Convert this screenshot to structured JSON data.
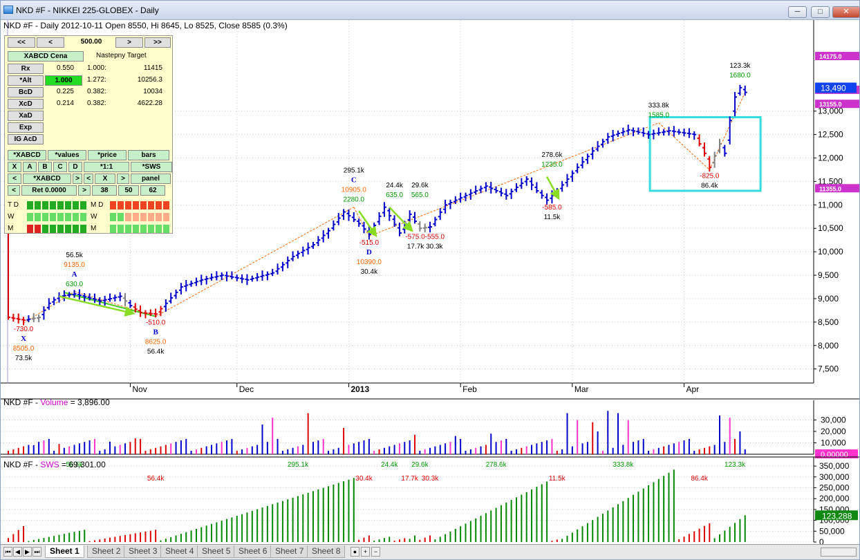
{
  "window": {
    "title": "NKD #F - NIKKEI 225-GLOBEX - Daily",
    "buttons": [
      "─",
      "□",
      "✕"
    ]
  },
  "header": {
    "main": "NKD #F - Daily 2012-10-11 Open 8550, Hi 8645, Lo 8525, Close 8585 (0.3%)"
  },
  "volume_header": {
    "prefix": "NKD #F - ",
    "name": "Volume",
    "suffix": " = 3,896.00"
  },
  "sws_header": {
    "prefix": "NKD #F - ",
    "name": "SWS",
    "suffix": " = 69,301.00"
  },
  "colors": {
    "up": "#0000cc",
    "down": "#dd0000",
    "grey": "#808080",
    "vol_mag": "#ff33cc",
    "sws_green": "#008800",
    "sws_red": "#dd0000",
    "fib_green": "#009900",
    "fib_orange": "#ff6600",
    "highlight_box": "#33dddd",
    "arrow": "#88dd22"
  },
  "dock": {
    "nav": {
      "first": "<<",
      "prev": "<",
      "step": "500.00",
      "next": ">",
      "last": ">>"
    },
    "title": "XABCD Cena",
    "target_label": "Nastepny Target",
    "rows": [
      {
        "name": "Rx",
        "value": "0.550",
        "ratio": "1.000:",
        "target": "11415"
      },
      {
        "name": "*Alt",
        "value": "1.000",
        "ratio": "1.272:",
        "target": "10256.3"
      },
      {
        "name": "BcD",
        "value": "0.225",
        "ratio": "0.382:",
        "target": "10034"
      },
      {
        "name": "XcD",
        "value": "0.214",
        "ratio": "0.382:",
        "target": "4622.28"
      },
      {
        "name": "XaD",
        "value": "",
        "ratio": "",
        "target": ""
      },
      {
        "name": "Exp",
        "value": "",
        "ratio": "",
        "target": ""
      },
      {
        "name": "IG AcD",
        "value": "",
        "ratio": "",
        "target": ""
      }
    ],
    "grid1": [
      "*XABCD",
      "*values",
      "*price",
      "bars"
    ],
    "grid2": [
      "X",
      "A",
      "B",
      "C",
      "D",
      "*1:1",
      "*SWS"
    ],
    "grid3": [
      "<",
      "*XABCD",
      ">",
      "<",
      "X",
      ">",
      "panel"
    ],
    "grid4": [
      "<",
      "Ret 0.0000",
      ">",
      "38",
      "50",
      "62"
    ],
    "tdwm_left": [
      "T D",
      "W",
      "M"
    ],
    "tdwm_right": [
      "M D",
      "W",
      "M"
    ]
  },
  "tabs": [
    "Sheet 1",
    "Sheet 2",
    "Sheet 3",
    "Sheet 4",
    "Sheet 5",
    "Sheet 6",
    "Sheet 7",
    "Sheet 8"
  ],
  "tab_nav": [
    "⏮",
    "◀",
    "▶",
    "⏭"
  ],
  "chart_data": [
    {
      "type": "ohlc",
      "title": "NKD #F - Daily 2012-10-11 Open 8550, Hi 8645, Lo 8525, Close 8585 (0.3%)",
      "ylim": [
        7200,
        14500
      ],
      "y_ticks": [
        "7,500",
        "8,000",
        "8,500",
        "9,000",
        "9,500",
        "10,000",
        "10,500",
        "11,000",
        "11,500",
        "12,000",
        "12,500",
        "13,000"
      ],
      "y_tick_values": [
        7500,
        8000,
        8500,
        9000,
        9500,
        10000,
        10500,
        11000,
        11500,
        12000,
        12500,
        13000
      ],
      "x_labels": [
        "Nov",
        "Dec",
        "2013",
        "Feb",
        "Mar",
        "Apr"
      ],
      "x_label_index": [
        24,
        45,
        67,
        89,
        111,
        133
      ],
      "bar_count": 146,
      "price_anchors": [
        [
          0,
          8600
        ],
        [
          3,
          8540
        ],
        [
          6,
          8600
        ],
        [
          8,
          8900
        ],
        [
          10,
          9050
        ],
        [
          13,
          9100
        ],
        [
          18,
          8950
        ],
        [
          22,
          9050
        ],
        [
          24,
          8850
        ],
        [
          26,
          8700
        ],
        [
          29,
          8670
        ],
        [
          31,
          8900
        ],
        [
          34,
          9250
        ],
        [
          38,
          9400
        ],
        [
          42,
          9500
        ],
        [
          47,
          9400
        ],
        [
          52,
          9550
        ],
        [
          56,
          9900
        ],
        [
          60,
          10150
        ],
        [
          63,
          10450
        ],
        [
          66,
          10850
        ],
        [
          69,
          10600
        ],
        [
          71,
          10370
        ],
        [
          74,
          10950
        ],
        [
          77,
          10400
        ],
        [
          79,
          10800
        ],
        [
          81,
          10500
        ],
        [
          83,
          10530
        ],
        [
          86,
          11000
        ],
        [
          90,
          11200
        ],
        [
          94,
          11400
        ],
        [
          98,
          11200
        ],
        [
          102,
          11550
        ],
        [
          104,
          11300
        ],
        [
          106,
          11100
        ],
        [
          108,
          11300
        ],
        [
          112,
          11800
        ],
        [
          115,
          12150
        ],
        [
          118,
          12450
        ],
        [
          122,
          12600
        ],
        [
          126,
          12500
        ],
        [
          130,
          12580
        ],
        [
          135,
          12500
        ],
        [
          137,
          12100
        ],
        [
          138,
          11800
        ],
        [
          140,
          12300
        ],
        [
          141,
          12100
        ],
        [
          142,
          12800
        ],
        [
          143,
          13300
        ],
        [
          144,
          13500
        ],
        [
          145,
          13400
        ]
      ],
      "bar_colors": {
        "red": [
          0,
          1,
          2,
          3,
          25,
          26,
          27,
          28,
          29,
          30,
          136,
          137,
          138
        ],
        "grey": [
          5,
          6,
          23,
          81,
          82,
          139,
          140
        ]
      },
      "last_price": "13,490",
      "right_labels": [
        {
          "text": "14175.0",
          "price": 14175,
          "color": "#cc33cc"
        },
        {
          "text": "13455.0",
          "price": 13455,
          "color": "#cc33cc"
        },
        {
          "text": "13155.0",
          "price": 13155,
          "color": "#cc33cc"
        },
        {
          "text": "11355.0",
          "price": 11355,
          "color": "#cc33cc"
        }
      ],
      "annotations": [
        {
          "i": 3,
          "price": 8480,
          "lines": [
            [
              "-730.0",
              "#dd0000"
            ],
            [
              "X",
              "#0000cc"
            ],
            [
              "8505.0",
              "#ff6600"
            ],
            [
              "73.5k",
              "#000"
            ]
          ],
          "below": true
        },
        {
          "i": 13,
          "price": 9150,
          "lines": [
            [
              "56.5k",
              "#000"
            ],
            [
              "9135.0",
              "#ff6600"
            ],
            [
              "A",
              "#0000cc"
            ],
            [
              "630.0",
              "#009900"
            ]
          ],
          "below": false
        },
        {
          "i": 29,
          "price": 8620,
          "lines": [
            [
              "-510.0",
              "#dd0000"
            ],
            [
              "B",
              "#0000cc"
            ],
            [
              "8625.0",
              "#ff6600"
            ],
            [
              "56.4k",
              "#000"
            ]
          ],
          "below": true
        },
        {
          "i": 68,
          "price": 10950,
          "lines": [
            [
              "295.1k",
              "#000"
            ],
            [
              "C",
              "#0000cc"
            ],
            [
              "10905.0",
              "#ff6600"
            ],
            [
              "2280.0",
              "#009900"
            ]
          ],
          "below": false
        },
        {
          "i": 71,
          "price": 10330,
          "lines": [
            [
              "-515.0",
              "#dd0000"
            ],
            [
              "D",
              "#0000cc"
            ],
            [
              "10390.0",
              "#ff6600"
            ],
            [
              "30.4k",
              "#000"
            ]
          ],
          "below": true
        },
        {
          "i": 76,
          "price": 11050,
          "lines": [
            [
              "24.4k",
              "#000"
            ],
            [
              "635.0",
              "#009900"
            ]
          ],
          "below": false
        },
        {
          "i": 81,
          "price": 11050,
          "lines": [
            [
              "29.6k",
              "#000"
            ],
            [
              "565.0",
              "#009900"
            ]
          ],
          "below": false
        },
        {
          "i": 82,
          "price": 10450,
          "lines": [
            [
              "-575.0-555.0",
              "#dd0000"
            ],
            [
              "17.7k 30.3k",
              "#000"
            ]
          ],
          "below": true
        },
        {
          "i": 107,
          "price": 11700,
          "lines": [
            [
              "278.6k",
              "#000"
            ],
            [
              "1235.0",
              "#009900"
            ]
          ],
          "below": false
        },
        {
          "i": 107,
          "price": 11080,
          "lines": [
            [
              "-585.0",
              "#dd0000"
            ],
            [
              "11.5k",
              "#000"
            ]
          ],
          "below": true
        },
        {
          "i": 128,
          "price": 12750,
          "lines": [
            [
              "333.8k",
              "#000"
            ],
            [
              "1585.0",
              "#009900"
            ]
          ],
          "below": false
        },
        {
          "i": 138,
          "price": 11750,
          "lines": [
            [
              "-825.0",
              "#dd0000"
            ],
            [
              "86.4k",
              "#000"
            ]
          ],
          "below": true
        },
        {
          "i": 144,
          "price": 13600,
          "lines": [
            [
              "123.3k",
              "#000"
            ],
            [
              "1680.0",
              "#009900"
            ]
          ],
          "below": false
        }
      ]
    },
    {
      "type": "bar",
      "title": "NKD #F - Volume = 3,896.00",
      "ylim": [
        0,
        40000
      ],
      "y_ticks": [
        "10,000",
        "20,000",
        "30,000"
      ],
      "y_tick_values": [
        10000,
        20000,
        30000
      ],
      "last_value": "0.00000",
      "spikes": [
        [
          5,
          8000
        ],
        [
          10,
          9000
        ],
        [
          20,
          11000
        ],
        [
          25,
          14000
        ],
        [
          50,
          26000
        ],
        [
          52,
          32000
        ],
        [
          59,
          36000
        ],
        [
          66,
          23000
        ],
        [
          80,
          17000
        ],
        [
          88,
          16000
        ],
        [
          95,
          18000
        ],
        [
          110,
          36000
        ],
        [
          112,
          30000
        ],
        [
          115,
          28000
        ],
        [
          116,
          20000
        ],
        [
          118,
          38000
        ],
        [
          120,
          36000
        ],
        [
          122,
          30000
        ],
        [
          140,
          34000
        ],
        [
          142,
          32000
        ],
        [
          144,
          20000
        ]
      ]
    },
    {
      "type": "bar",
      "title": "NKD #F - SWS = 69,301.00",
      "ylim": [
        0,
        360000
      ],
      "y_ticks": [
        "0",
        "50,000",
        "100,000",
        "150,000",
        "200,000",
        "250,000",
        "300,000",
        "350,000"
      ],
      "y_tick_values": [
        0,
        50000,
        100000,
        150000,
        200000,
        250000,
        300000,
        350000
      ],
      "last_value": "123,288",
      "swings": [
        {
          "start": 0,
          "end": 3,
          "peak": 73500,
          "color": "red"
        },
        {
          "start": 4,
          "end": 15,
          "peak": 56500,
          "color": "green"
        },
        {
          "start": 16,
          "end": 29,
          "peak": 56400,
          "color": "red"
        },
        {
          "start": 30,
          "end": 68,
          "peak": 295100,
          "color": "green"
        },
        {
          "start": 69,
          "end": 71,
          "peak": 30400,
          "color": "red"
        },
        {
          "start": 72,
          "end": 75,
          "peak": 24400,
          "color": "green"
        },
        {
          "start": 76,
          "end": 78,
          "peak": 17700,
          "color": "red"
        },
        {
          "start": 79,
          "end": 80,
          "peak": 29600,
          "color": "green"
        },
        {
          "start": 81,
          "end": 83,
          "peak": 30300,
          "color": "red"
        },
        {
          "start": 84,
          "end": 106,
          "peak": 278600,
          "color": "green"
        },
        {
          "start": 107,
          "end": 108,
          "peak": 11500,
          "color": "red"
        },
        {
          "start": 109,
          "end": 131,
          "peak": 333800,
          "color": "green"
        },
        {
          "start": 132,
          "end": 138,
          "peak": 86400,
          "color": "red"
        },
        {
          "start": 139,
          "end": 145,
          "peak": 123300,
          "color": "green"
        }
      ],
      "labels": [
        {
          "i": 13,
          "text": "56.5k",
          "color": "#009900",
          "row": 0
        },
        {
          "i": 29,
          "text": "56.4k",
          "color": "#dd0000",
          "row": 1
        },
        {
          "i": 57,
          "text": "295.1k",
          "color": "#009900",
          "row": 0
        },
        {
          "i": 70,
          "text": "30.4k",
          "color": "#dd0000",
          "row": 1
        },
        {
          "i": 75,
          "text": "24.4k",
          "color": "#009900",
          "row": 0
        },
        {
          "i": 79,
          "text": "17.7k",
          "color": "#dd0000",
          "row": 1
        },
        {
          "i": 81,
          "text": "29.6k",
          "color": "#009900",
          "row": 0
        },
        {
          "i": 83,
          "text": "30.3k",
          "color": "#dd0000",
          "row": 1
        },
        {
          "i": 96,
          "text": "278.6k",
          "color": "#009900",
          "row": 0
        },
        {
          "i": 108,
          "text": "11.5k",
          "color": "#dd0000",
          "row": 1
        },
        {
          "i": 121,
          "text": "333.8k",
          "color": "#009900",
          "row": 0
        },
        {
          "i": 136,
          "text": "86.4k",
          "color": "#dd0000",
          "row": 1
        },
        {
          "i": 143,
          "text": "123.3k",
          "color": "#009900",
          "row": 0
        }
      ]
    }
  ]
}
